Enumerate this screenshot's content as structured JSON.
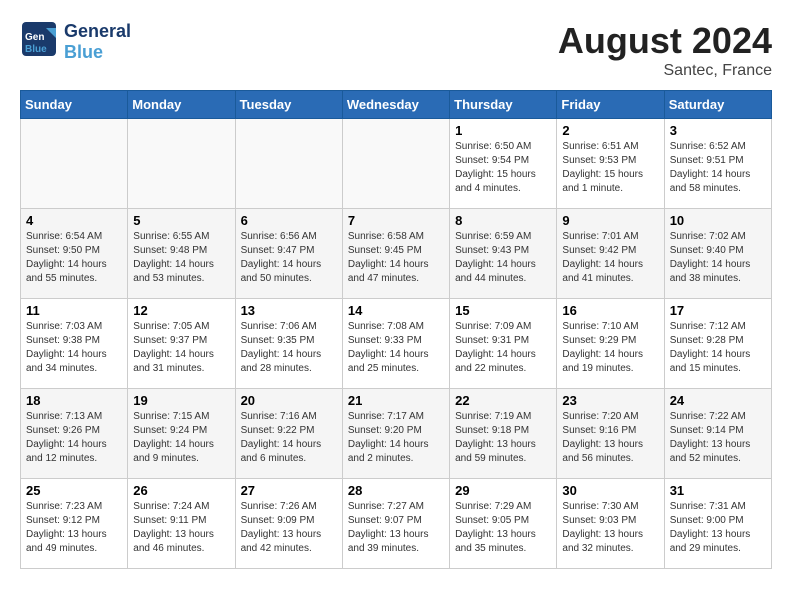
{
  "header": {
    "logo_line1": "General",
    "logo_line2": "Blue",
    "month_title": "August 2024",
    "location": "Santec, France"
  },
  "weekdays": [
    "Sunday",
    "Monday",
    "Tuesday",
    "Wednesday",
    "Thursday",
    "Friday",
    "Saturday"
  ],
  "weeks": [
    [
      {
        "day": "",
        "info": ""
      },
      {
        "day": "",
        "info": ""
      },
      {
        "day": "",
        "info": ""
      },
      {
        "day": "",
        "info": ""
      },
      {
        "day": "1",
        "info": "Sunrise: 6:50 AM\nSunset: 9:54 PM\nDaylight: 15 hours\nand 4 minutes."
      },
      {
        "day": "2",
        "info": "Sunrise: 6:51 AM\nSunset: 9:53 PM\nDaylight: 15 hours\nand 1 minute."
      },
      {
        "day": "3",
        "info": "Sunrise: 6:52 AM\nSunset: 9:51 PM\nDaylight: 14 hours\nand 58 minutes."
      }
    ],
    [
      {
        "day": "4",
        "info": "Sunrise: 6:54 AM\nSunset: 9:50 PM\nDaylight: 14 hours\nand 55 minutes."
      },
      {
        "day": "5",
        "info": "Sunrise: 6:55 AM\nSunset: 9:48 PM\nDaylight: 14 hours\nand 53 minutes."
      },
      {
        "day": "6",
        "info": "Sunrise: 6:56 AM\nSunset: 9:47 PM\nDaylight: 14 hours\nand 50 minutes."
      },
      {
        "day": "7",
        "info": "Sunrise: 6:58 AM\nSunset: 9:45 PM\nDaylight: 14 hours\nand 47 minutes."
      },
      {
        "day": "8",
        "info": "Sunrise: 6:59 AM\nSunset: 9:43 PM\nDaylight: 14 hours\nand 44 minutes."
      },
      {
        "day": "9",
        "info": "Sunrise: 7:01 AM\nSunset: 9:42 PM\nDaylight: 14 hours\nand 41 minutes."
      },
      {
        "day": "10",
        "info": "Sunrise: 7:02 AM\nSunset: 9:40 PM\nDaylight: 14 hours\nand 38 minutes."
      }
    ],
    [
      {
        "day": "11",
        "info": "Sunrise: 7:03 AM\nSunset: 9:38 PM\nDaylight: 14 hours\nand 34 minutes."
      },
      {
        "day": "12",
        "info": "Sunrise: 7:05 AM\nSunset: 9:37 PM\nDaylight: 14 hours\nand 31 minutes."
      },
      {
        "day": "13",
        "info": "Sunrise: 7:06 AM\nSunset: 9:35 PM\nDaylight: 14 hours\nand 28 minutes."
      },
      {
        "day": "14",
        "info": "Sunrise: 7:08 AM\nSunset: 9:33 PM\nDaylight: 14 hours\nand 25 minutes."
      },
      {
        "day": "15",
        "info": "Sunrise: 7:09 AM\nSunset: 9:31 PM\nDaylight: 14 hours\nand 22 minutes."
      },
      {
        "day": "16",
        "info": "Sunrise: 7:10 AM\nSunset: 9:29 PM\nDaylight: 14 hours\nand 19 minutes."
      },
      {
        "day": "17",
        "info": "Sunrise: 7:12 AM\nSunset: 9:28 PM\nDaylight: 14 hours\nand 15 minutes."
      }
    ],
    [
      {
        "day": "18",
        "info": "Sunrise: 7:13 AM\nSunset: 9:26 PM\nDaylight: 14 hours\nand 12 minutes."
      },
      {
        "day": "19",
        "info": "Sunrise: 7:15 AM\nSunset: 9:24 PM\nDaylight: 14 hours\nand 9 minutes."
      },
      {
        "day": "20",
        "info": "Sunrise: 7:16 AM\nSunset: 9:22 PM\nDaylight: 14 hours\nand 6 minutes."
      },
      {
        "day": "21",
        "info": "Sunrise: 7:17 AM\nSunset: 9:20 PM\nDaylight: 14 hours\nand 2 minutes."
      },
      {
        "day": "22",
        "info": "Sunrise: 7:19 AM\nSunset: 9:18 PM\nDaylight: 13 hours\nand 59 minutes."
      },
      {
        "day": "23",
        "info": "Sunrise: 7:20 AM\nSunset: 9:16 PM\nDaylight: 13 hours\nand 56 minutes."
      },
      {
        "day": "24",
        "info": "Sunrise: 7:22 AM\nSunset: 9:14 PM\nDaylight: 13 hours\nand 52 minutes."
      }
    ],
    [
      {
        "day": "25",
        "info": "Sunrise: 7:23 AM\nSunset: 9:12 PM\nDaylight: 13 hours\nand 49 minutes."
      },
      {
        "day": "26",
        "info": "Sunrise: 7:24 AM\nSunset: 9:11 PM\nDaylight: 13 hours\nand 46 minutes."
      },
      {
        "day": "27",
        "info": "Sunrise: 7:26 AM\nSunset: 9:09 PM\nDaylight: 13 hours\nand 42 minutes."
      },
      {
        "day": "28",
        "info": "Sunrise: 7:27 AM\nSunset: 9:07 PM\nDaylight: 13 hours\nand 39 minutes."
      },
      {
        "day": "29",
        "info": "Sunrise: 7:29 AM\nSunset: 9:05 PM\nDaylight: 13 hours\nand 35 minutes."
      },
      {
        "day": "30",
        "info": "Sunrise: 7:30 AM\nSunset: 9:03 PM\nDaylight: 13 hours\nand 32 minutes."
      },
      {
        "day": "31",
        "info": "Sunrise: 7:31 AM\nSunset: 9:00 PM\nDaylight: 13 hours\nand 29 minutes."
      }
    ]
  ]
}
